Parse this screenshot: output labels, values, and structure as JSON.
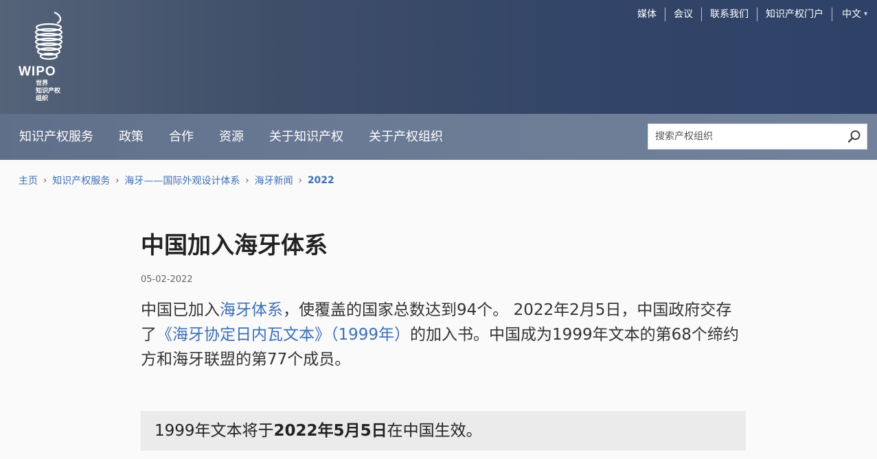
{
  "header": {
    "logo_text": "WIPO",
    "logo_subtext": "世界\n知识产权\n组织",
    "utility_nav": [
      "媒体",
      "会议",
      "联系我们",
      "知识产权门户"
    ],
    "language": "中文"
  },
  "mainnav": {
    "items": [
      "知识产权服务",
      "政策",
      "合作",
      "资源",
      "关于知识产权",
      "关于产权组织"
    ],
    "search_placeholder": "搜索产权组织"
  },
  "breadcrumb": {
    "items": [
      "主页",
      "知识产权服务",
      "海牙——国际外观设计体系",
      "海牙新闻"
    ],
    "current": "2022"
  },
  "article": {
    "title": "中国加入海牙体系",
    "date": "05-02-2022",
    "lede_1": "中国已加入",
    "lede_link_1": "海牙体系",
    "lede_2": "，使覆盖的国家总数达到94个。 2022年2月5日，中国政府交存了",
    "lede_link_2": "《海牙协定日内瓦文本》（1999年）",
    "lede_3": "的加入书。中国成为1999年文本的第68个缔约方和海牙联盟的第77个成员。",
    "notice_1": "1999年文本将于",
    "notice_bold": "2022年5月5日",
    "notice_2": "在中国生效。"
  },
  "colors": {
    "link": "#3d6fb5",
    "header_bg": "#334568",
    "nav_bg": "#6a7a94",
    "notice_bg": "#ebebeb"
  },
  "icons": {
    "search": "search-icon",
    "caret": "chevron-down-icon"
  }
}
